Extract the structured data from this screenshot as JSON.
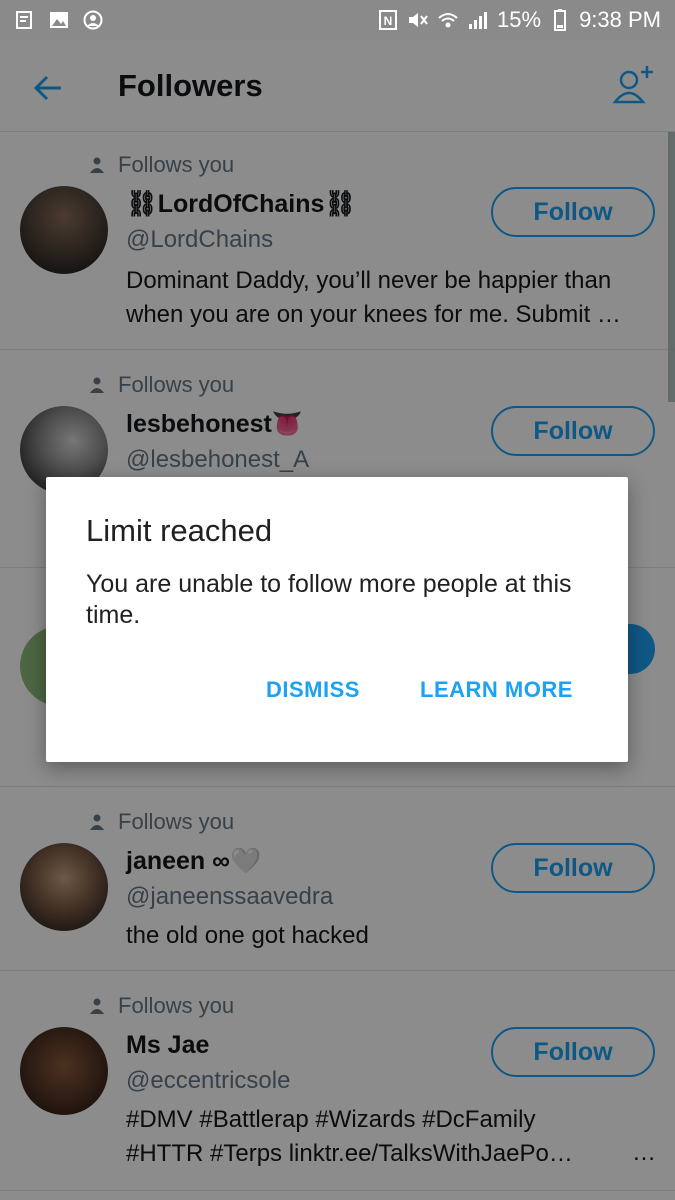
{
  "status_bar": {
    "battery": "15%",
    "time": "9:38 PM"
  },
  "header": {
    "title": "Followers"
  },
  "followers": [
    {
      "follows_label": "Follows you",
      "name": "⛓LordOfChains⛓",
      "handle": "@LordChains",
      "bio_line1": "Dominant Daddy, you’ll never be happier than",
      "bio_line2": "when you are on your knees for me. Submit …",
      "button": "Follow"
    },
    {
      "follows_label": "Follows you",
      "name": "lesbehonest👅",
      "handle": "@lesbehonest_A",
      "button": "Follow"
    },
    {
      "follows_label": "Follows you",
      "name": "janeen ∞🤍",
      "handle": "@janeenssaavedra",
      "bio_line1": "the old one got hacked",
      "button": "Follow"
    },
    {
      "follows_label": "Follows you",
      "name": "Ms Jae",
      "handle": "@eccentricsole",
      "bio_line1": "#DMV #Battlerap #Wizards #DcFamily",
      "bio_line2": "#HTTR #Terps linktr.ee/TalksWithJaePo…",
      "more": "…",
      "button": "Follow"
    }
  ],
  "dialog": {
    "title": "Limit reached",
    "message": "You are unable to follow more people at this time.",
    "dismiss_label": "DISMISS",
    "learn_more_label": "LEARN MORE"
  },
  "colors": {
    "accent": "#1da1f2",
    "secondary_text": "#657786"
  }
}
